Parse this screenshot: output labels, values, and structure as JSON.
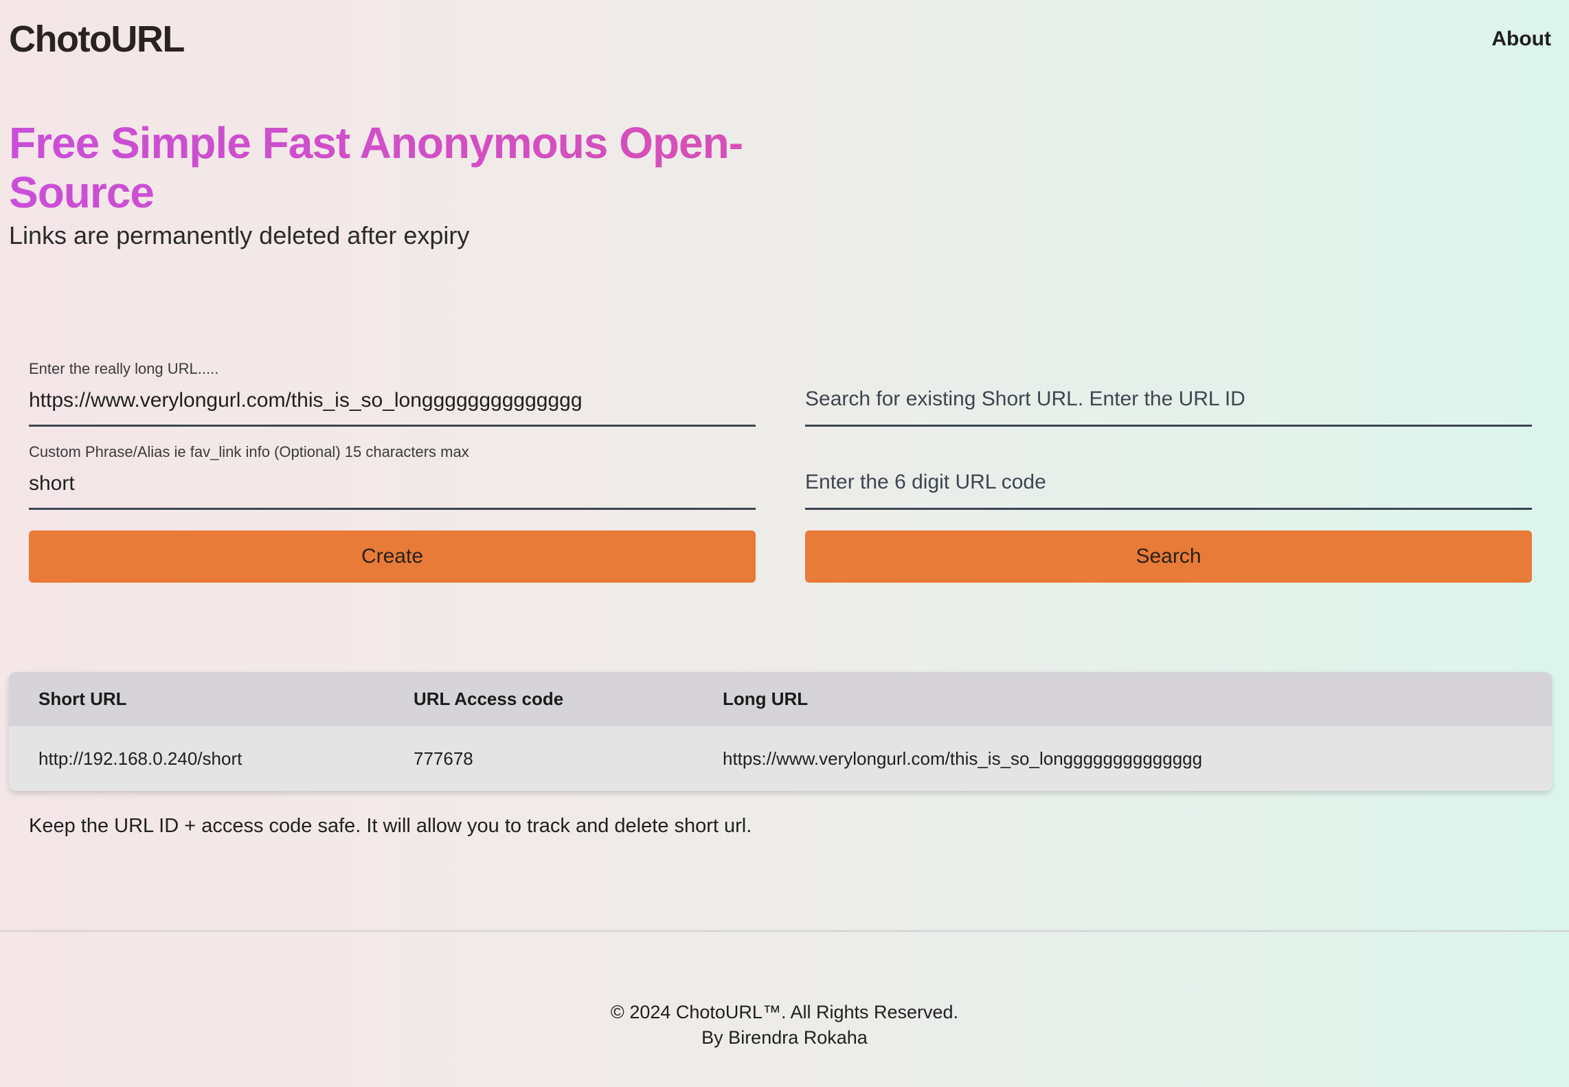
{
  "header": {
    "logo": "ChotoURL",
    "about_label": "About"
  },
  "hero": {
    "title": "Free Simple Fast Anonymous Open-Source",
    "subtitle": "Links are permanently deleted after expiry"
  },
  "create_form": {
    "long_url_label": "Enter the really long URL.....",
    "long_url_value": "https://www.verylongurl.com/this_is_so_longggggggggggggg",
    "alias_label": "Custom Phrase/Alias ie fav_link info (Optional) 15 characters max",
    "alias_value": "short",
    "create_label": "Create"
  },
  "search_form": {
    "url_id_placeholder": "Search for existing Short URL. Enter the URL ID",
    "code_placeholder": "Enter the 6 digit URL code",
    "search_label": "Search"
  },
  "results": {
    "headers": [
      "Short URL",
      "URL Access code",
      "Long URL"
    ],
    "rows": [
      [
        "http://192.168.0.240/short",
        "777678",
        "https://www.verylongurl.com/this_is_so_longggggggggggggg"
      ]
    ],
    "note": "Keep the URL ID + access code safe. It will allow you to track and delete short url."
  },
  "footer": {
    "copyright": "© 2024 ChotoURL™. All Rights Reserved.",
    "author": "By Birendra Rokaha"
  },
  "colors": {
    "accent_button": "#e87b38",
    "title_gradient_start": "#c94fd8",
    "title_gradient_end": "#d84fb4"
  }
}
